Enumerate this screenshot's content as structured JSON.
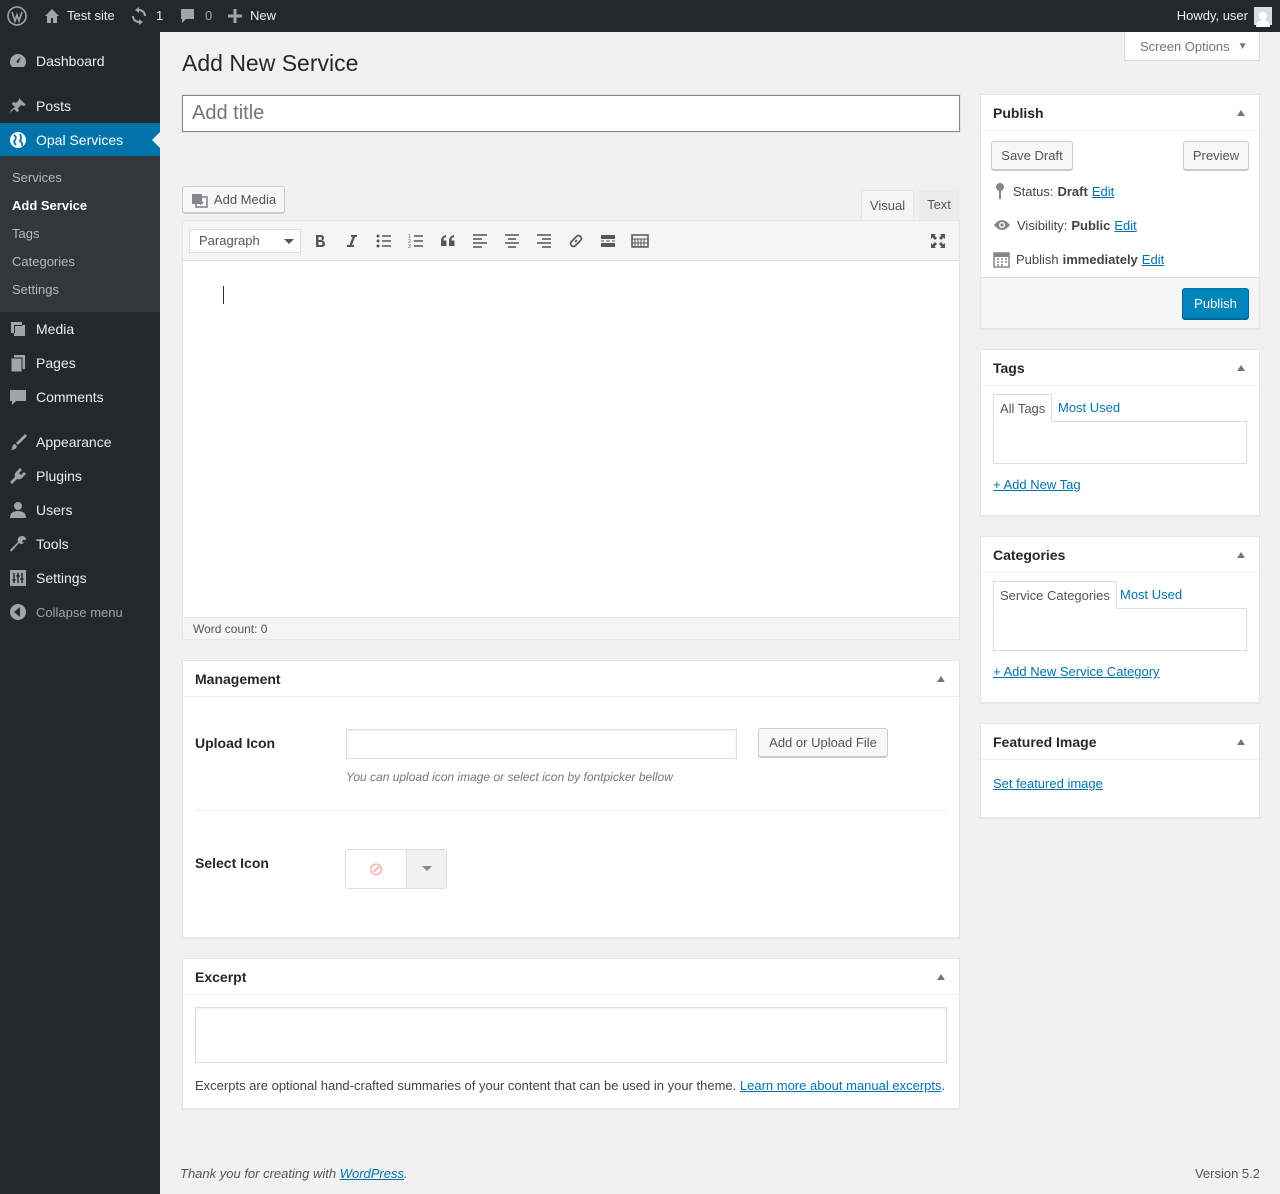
{
  "adminbar": {
    "site_name": "Test site",
    "updates_count": "1",
    "comments_count": "0",
    "new_label": "New",
    "greeting": "Howdy, user"
  },
  "sidebar": {
    "items": [
      {
        "label": "Dashboard",
        "icon": "dashboard-icon"
      },
      {
        "label": "Posts",
        "icon": "pin-icon"
      },
      {
        "label": "Opal Services",
        "icon": "globe-icon"
      },
      {
        "label": "Media",
        "icon": "media-icon"
      },
      {
        "label": "Pages",
        "icon": "pages-icon"
      },
      {
        "label": "Comments",
        "icon": "comment-icon"
      },
      {
        "label": "Appearance",
        "icon": "brush-icon"
      },
      {
        "label": "Plugins",
        "icon": "plugin-icon"
      },
      {
        "label": "Users",
        "icon": "user-icon"
      },
      {
        "label": "Tools",
        "icon": "wrench-icon"
      },
      {
        "label": "Settings",
        "icon": "settings-icon"
      }
    ],
    "submenu": [
      "Services",
      "Add Service",
      "Tags",
      "Categories",
      "Settings"
    ],
    "collapse_label": "Collapse menu"
  },
  "header": {
    "screen_options": "Screen Options",
    "title": "Add New Service",
    "title_placeholder": "Add title"
  },
  "editor": {
    "add_media": "Add Media",
    "tab_visual": "Visual",
    "tab_text": "Text",
    "format": "Paragraph",
    "word_count": "Word count: 0"
  },
  "publish": {
    "title": "Publish",
    "save_draft": "Save Draft",
    "preview": "Preview",
    "status_label": "Status:",
    "status_value": "Draft",
    "visibility_label": "Visibility:",
    "visibility_value": "Public",
    "schedule_label": "Publish",
    "schedule_value": "immediately",
    "edit_link": "Edit",
    "publish_button": "Publish"
  },
  "tags": {
    "title": "Tags",
    "tab_all": "All Tags",
    "tab_most": "Most Used",
    "add_link": "+ Add New Tag"
  },
  "categories": {
    "title": "Categories",
    "tab_all": "Service Categories",
    "tab_most": "Most Used",
    "add_link": "+ Add New Service Category"
  },
  "featured": {
    "title": "Featured Image",
    "link": "Set featured image"
  },
  "management": {
    "title": "Management",
    "upload_label": "Upload Icon",
    "upload_button": "Add or Upload File",
    "upload_help": "You can upload icon image or select icon by fontpicker bellow",
    "select_label": "Select Icon"
  },
  "excerpt": {
    "title": "Excerpt",
    "help_text": "Excerpts are optional hand-crafted summaries of your content that can be used in your theme.",
    "help_link": "Learn more about manual excerpts"
  },
  "footer": {
    "thanks_prefix": "Thank you for creating with",
    "thanks_link": "WordPress",
    "version": "Version 5.2"
  }
}
